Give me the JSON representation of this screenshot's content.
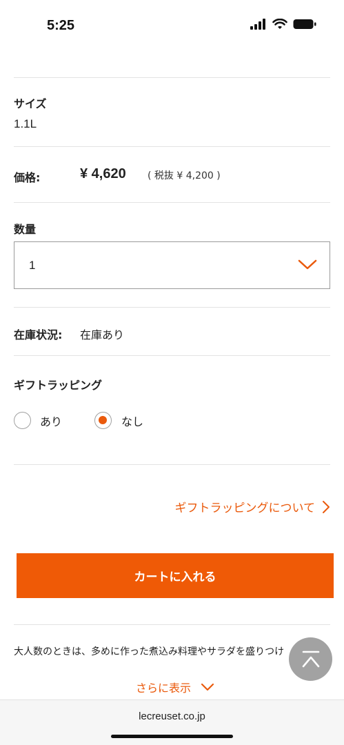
{
  "status_bar": {
    "time": "5:25"
  },
  "size": {
    "label": "サイズ",
    "value": "1.1L"
  },
  "price": {
    "label": "価格:",
    "amount": "¥ 4,620",
    "tax_excluded": "( 税抜 ¥ 4,200 )"
  },
  "quantity": {
    "label": "数量",
    "selected": "1"
  },
  "stock": {
    "label": "在庫状況:",
    "value": "在庫あり"
  },
  "gift_wrapping": {
    "label": "ギフトラッピング",
    "options": [
      {
        "label": "あり",
        "checked": false
      },
      {
        "label": "なし",
        "checked": true
      }
    ],
    "info_link": "ギフトラッピングについて"
  },
  "cart_button": {
    "label": "カートに入れる"
  },
  "description": {
    "text": "大人数のときは、多めに作った煮込み料理やサラダを盛りつけ"
  },
  "more_link": {
    "label": "さらに表示"
  },
  "browser": {
    "url": "lecreuset.co.jp"
  },
  "colors": {
    "accent": "#ea5a0c",
    "button": "#ef5a06"
  }
}
